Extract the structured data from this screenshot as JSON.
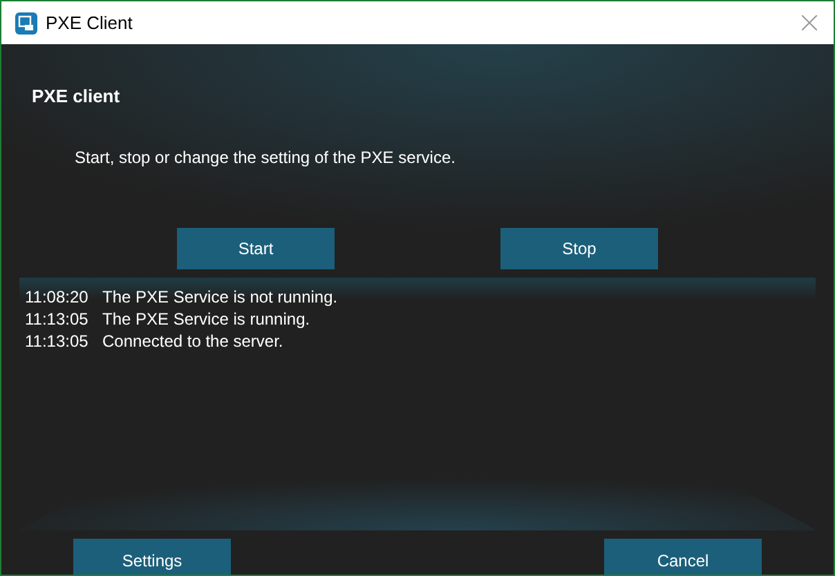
{
  "window": {
    "title": "PXE Client"
  },
  "heading": "PXE client",
  "description": "Start, stop or change the setting of the PXE service.",
  "service_buttons": [
    "Start",
    "Stop"
  ],
  "log": [
    {
      "time": "11:08:20",
      "message": "The PXE Service is not running."
    },
    {
      "time": "11:13:05",
      "message": "The PXE Service is running."
    },
    {
      "time": "11:13:05",
      "message": "Connected to the server."
    }
  ],
  "footer_buttons": [
    "Settings",
    "Cancel"
  ]
}
